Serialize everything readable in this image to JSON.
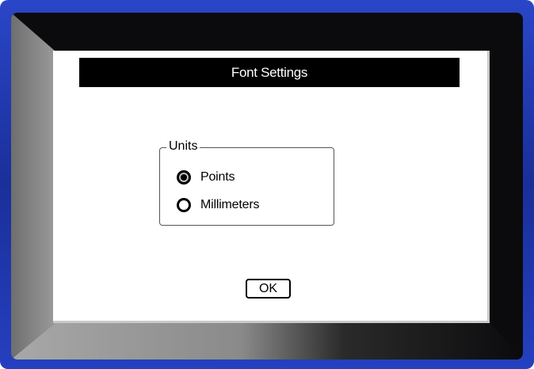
{
  "dialog": {
    "title": "Font Settings",
    "units": {
      "legend": "Units",
      "options": [
        {
          "label": "Points",
          "selected": true
        },
        {
          "label": "Millimeters",
          "selected": false
        }
      ]
    },
    "ok_label": "OK"
  },
  "colors": {
    "device_frame": "#2540c0",
    "bezel": "#0b0b0d",
    "title_bar": "#000000",
    "screen": "#ffffff"
  }
}
